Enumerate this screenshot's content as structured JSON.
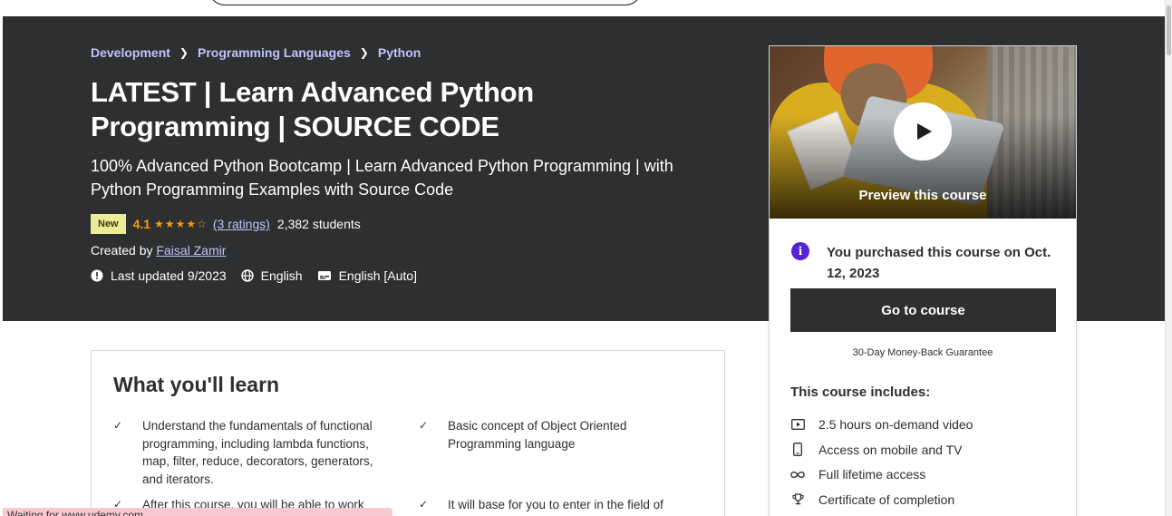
{
  "breadcrumb": {
    "items": [
      "Development",
      "Programming Languages",
      "Python"
    ]
  },
  "course": {
    "title": "LATEST | Learn Advanced Python Programming | SOURCE CODE",
    "subtitle": "100% Advanced Python Bootcamp | Learn Advanced Python Programming | with Python Programming Examples with Source Code",
    "badge": "New",
    "rating": "4.1",
    "stars": "★★★★☆",
    "ratings_count": "(3 ratings)",
    "students": "2,382 students",
    "created_by_label": "Created by",
    "author": "Faisal Zamir",
    "last_updated": "Last updated 9/2023",
    "language": "English",
    "captions": "English [Auto]"
  },
  "sidebar": {
    "preview_label": "Preview this course",
    "purchased_text": "You purchased this course on Oct. 12, 2023",
    "go_button": "Go to course",
    "guarantee": "30-Day Money-Back Guarantee",
    "includes_title": "This course includes:",
    "includes": [
      {
        "icon": "video-icon",
        "label": "2.5 hours on-demand video"
      },
      {
        "icon": "mobile-icon",
        "label": "Access on mobile and TV"
      },
      {
        "icon": "infinity-icon",
        "label": "Full lifetime access"
      },
      {
        "icon": "trophy-icon",
        "label": "Certificate of completion"
      }
    ]
  },
  "learn": {
    "title": "What you'll learn",
    "items": [
      "Understand the fundamentals of functional programming, including lambda functions, map, filter, reduce, decorators, generators, and iterators.",
      "Basic concept of Object Oriented Programming language",
      "After this course, you will be able to work",
      "It will base for you to enter in the field of"
    ]
  },
  "status": {
    "text": "Waiting for www.udemy.com..."
  },
  "colors": {
    "hero_bg": "#2d2f31",
    "link": "#c0c4fc",
    "star": "#f69c08",
    "badge_bg": "#eceb98",
    "info": "#5624d0"
  }
}
